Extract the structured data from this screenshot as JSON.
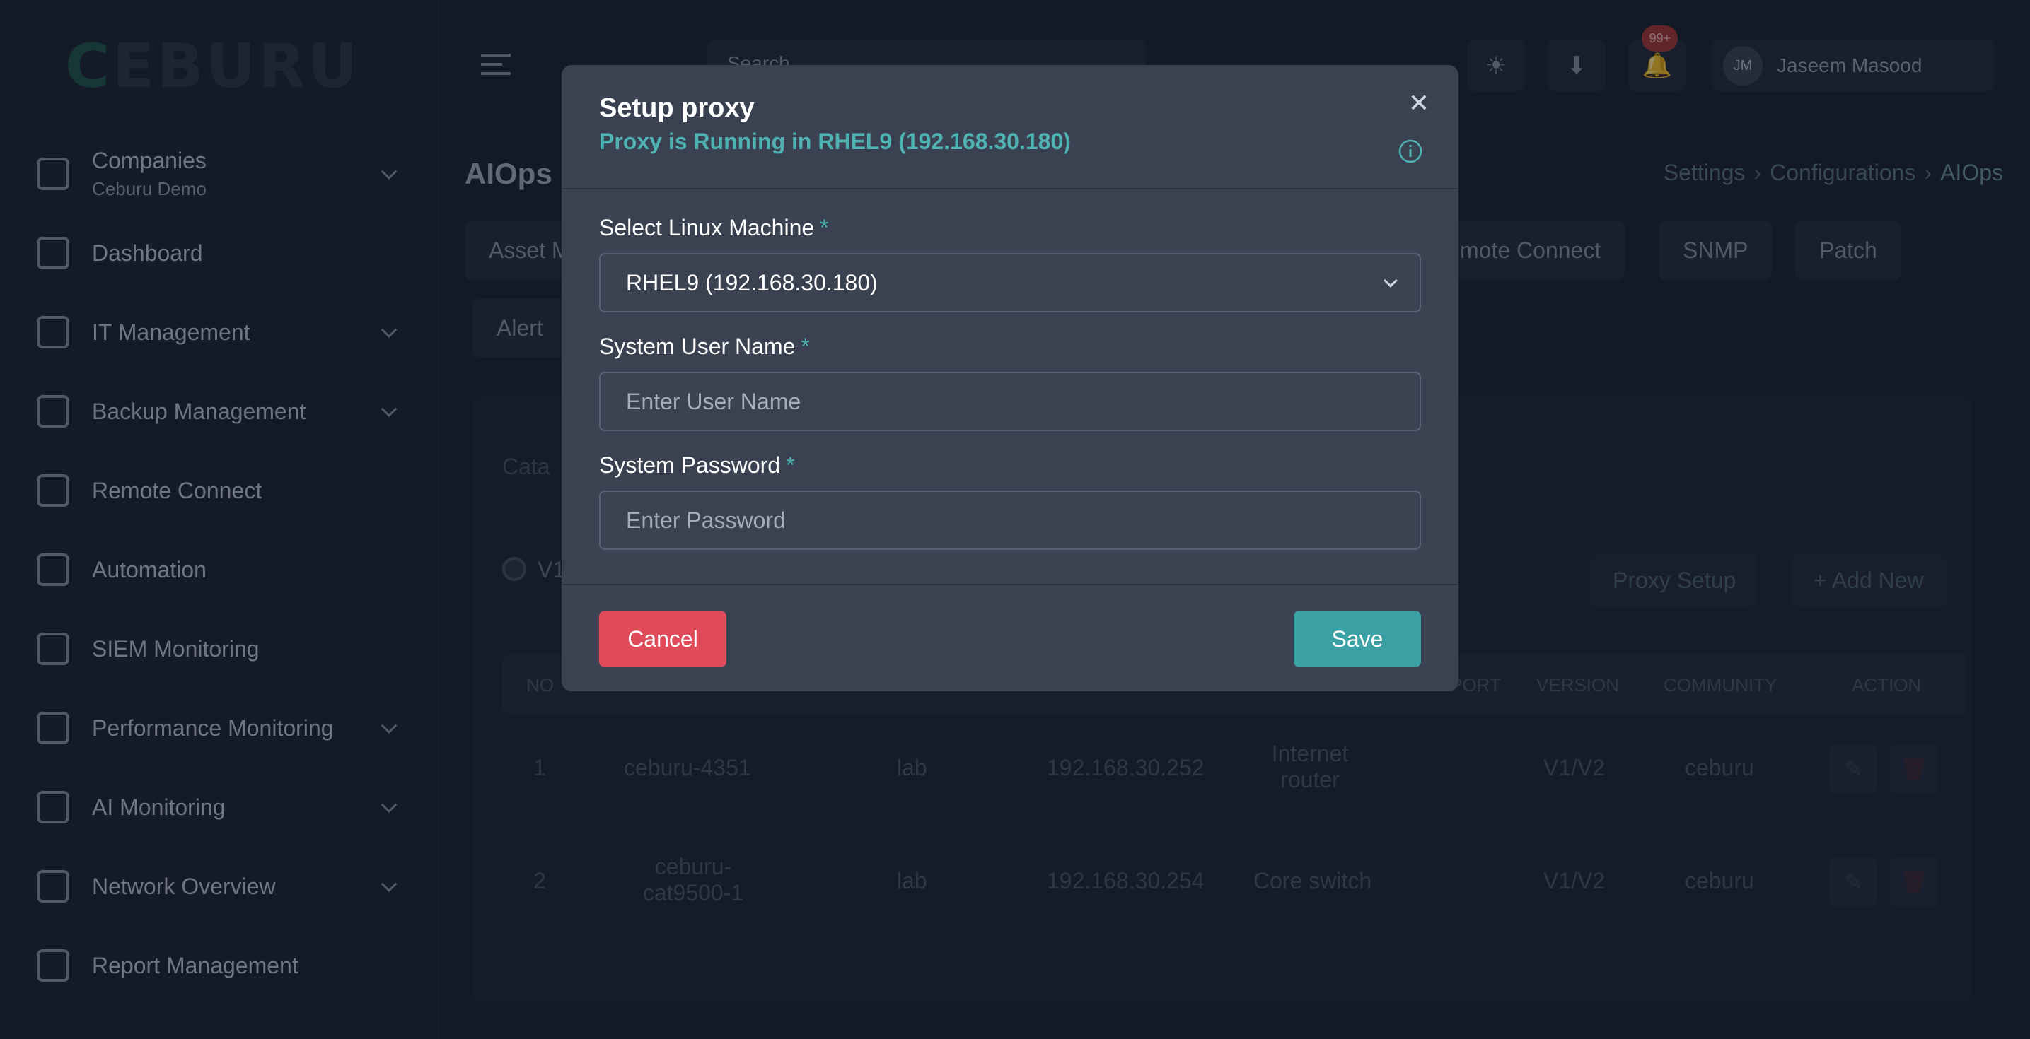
{
  "app": {
    "logo": "CEBURU",
    "sidebar": {
      "items": [
        {
          "label": "Companies",
          "sub": "Ceburu Demo",
          "icon": "building-icon",
          "expandable": true
        },
        {
          "label": "Dashboard",
          "icon": "dashboard-icon",
          "expandable": false
        },
        {
          "label": "IT Management",
          "icon": "it-management-icon",
          "expandable": true
        },
        {
          "label": "Backup Management",
          "icon": "backup-icon",
          "expandable": true
        },
        {
          "label": "Remote Connect",
          "icon": "remote-icon",
          "expandable": false
        },
        {
          "label": "Automation",
          "icon": "automation-icon",
          "expandable": false
        },
        {
          "label": "SIEM Monitoring",
          "icon": "siem-icon",
          "expandable": false
        },
        {
          "label": "Performance Monitoring",
          "icon": "performance-icon",
          "expandable": true
        },
        {
          "label": "AI Monitoring",
          "icon": "ai-monitor-icon",
          "expandable": true
        },
        {
          "label": "Network Overview",
          "icon": "network-icon",
          "expandable": true
        },
        {
          "label": "Report Management",
          "icon": "report-icon",
          "expandable": false
        }
      ]
    },
    "topbar": {
      "search_label": "Search",
      "search_placeholder": "Search",
      "notification_count": "99+",
      "user_initials": "JM",
      "user_name": "Jaseem Masood"
    },
    "page": {
      "title": "AIOps",
      "breadcrumb": [
        "Settings",
        "Configurations",
        "AIOps"
      ],
      "tabs": [
        "Asset M",
        "mote Connect",
        "SNMP",
        "Patch",
        "Alert"
      ],
      "card_subtitle": "Cata",
      "radio_label": "V1",
      "proxy_setup_label": "Proxy Setup",
      "add_new_label": "+ Add New",
      "table": {
        "headers": [
          "NO",
          "PORT",
          "VERSION",
          "COMMUNITY",
          "ACTION"
        ],
        "rows": [
          {
            "no": "1",
            "name": "ceburu-4351",
            "location": "lab",
            "ip": "192.168.30.252",
            "desc": "Internet router",
            "version": "V1/V2",
            "community": "ceburu"
          },
          {
            "no": "2",
            "name": "ceburu-cat9500-1",
            "location": "lab",
            "ip": "192.168.30.254",
            "desc": "Core switch",
            "version": "V1/V2",
            "community": "ceburu"
          }
        ]
      }
    }
  },
  "modal": {
    "title": "Setup proxy",
    "status": "Proxy is Running in RHEL9 (192.168.30.180)",
    "fields": {
      "machine": {
        "label": "Select Linux Machine",
        "required_mark": "*",
        "value": "RHEL9 (192.168.30.180)"
      },
      "username": {
        "label": "System User Name",
        "required_mark": "*",
        "placeholder": "Enter User Name",
        "value": ""
      },
      "password": {
        "label": "System Password",
        "required_mark": "*",
        "placeholder": "Enter Password",
        "value": ""
      }
    },
    "cancel_label": "Cancel",
    "save_label": "Save"
  },
  "colors": {
    "accent": "#4fb3b3",
    "cancel": "#e04b5a",
    "save": "#3aa0a4",
    "modal_bg": "#3a4252"
  }
}
